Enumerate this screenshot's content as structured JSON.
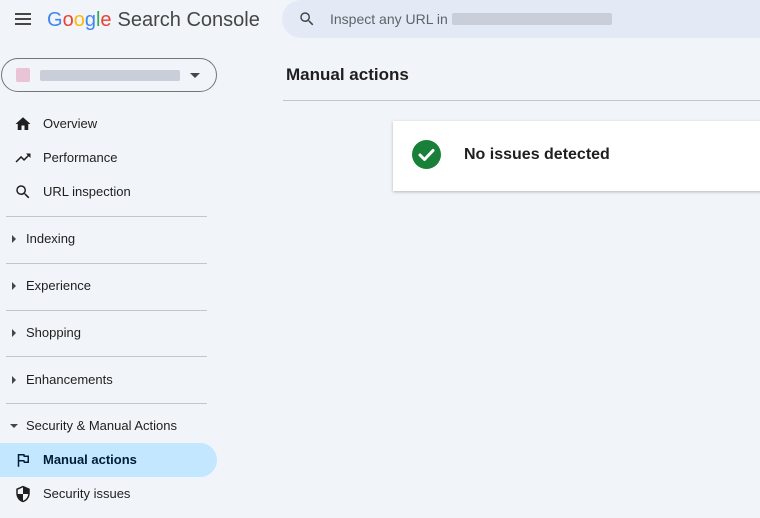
{
  "header": {
    "brand_parts": [
      "G",
      "o",
      "o",
      "g",
      "l",
      "e"
    ],
    "product_name": "Search Console",
    "search_placeholder": "Inspect any URL in"
  },
  "sidebar": {
    "top_items": [
      {
        "label": "Overview",
        "icon": "home-icon"
      },
      {
        "label": "Performance",
        "icon": "trending-up-icon"
      },
      {
        "label": "URL inspection",
        "icon": "search-icon"
      }
    ],
    "sections": [
      {
        "label": "Indexing",
        "expanded": false
      },
      {
        "label": "Experience",
        "expanded": false
      },
      {
        "label": "Shopping",
        "expanded": false
      },
      {
        "label": "Enhancements",
        "expanded": false
      },
      {
        "label": "Security & Manual Actions",
        "expanded": true
      }
    ],
    "security_items": [
      {
        "label": "Manual actions",
        "icon": "flag-icon",
        "active": true
      },
      {
        "label": "Security issues",
        "icon": "shield-icon",
        "active": false
      }
    ]
  },
  "main": {
    "title": "Manual actions",
    "status_message": "No issues detected",
    "status_icon": "check-circle-icon"
  },
  "colors": {
    "background": "#f1f4f9",
    "search_bg": "#e3eaf6",
    "active_nav_bg": "#c2e7ff",
    "success_green": "#188038"
  }
}
